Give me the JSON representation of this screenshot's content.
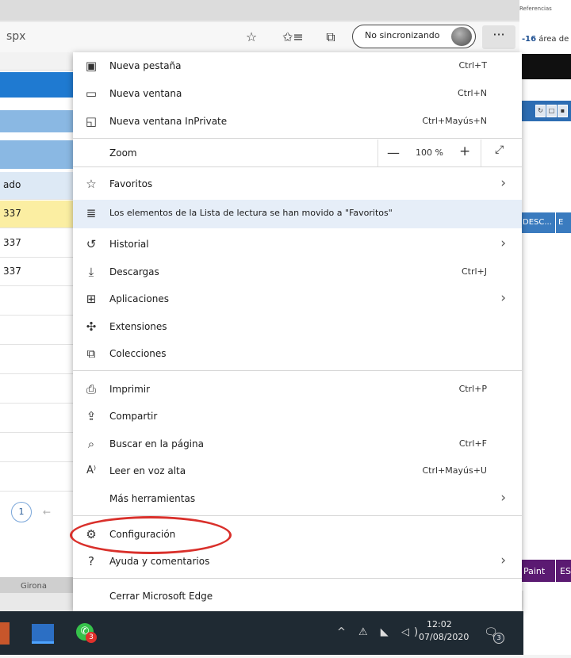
{
  "browser": {
    "url_fragment": "spx",
    "sync_label": "No sincronizando",
    "more_label": "···",
    "toolbar_icons": [
      "star-outline-icon",
      "favorites-bar-icon",
      "collections-icon"
    ]
  },
  "menu": {
    "items": [
      {
        "label": "Nueva pestaña",
        "shortcut": "Ctrl+T",
        "icon": "new-tab-icon",
        "glyph": "▣"
      },
      {
        "label": "Nueva ventana",
        "shortcut": "Ctrl+N",
        "icon": "new-window-icon",
        "glyph": "▭"
      },
      {
        "label": "Nueva ventana InPrivate",
        "shortcut": "Ctrl+Mayús+N",
        "icon": "inprivate-icon",
        "glyph": "◱"
      },
      {
        "label": "Zoom",
        "icon": "",
        "glyph": ""
      },
      {
        "label": "Favoritos",
        "icon": "favorites-icon",
        "glyph": "☆"
      },
      {
        "label": "Los elementos de la Lista de lectura se han movido a \"Favoritos\"",
        "icon": "reading-list-icon",
        "glyph": "≣"
      },
      {
        "label": "Historial",
        "icon": "history-icon",
        "glyph": "↺"
      },
      {
        "label": "Descargas",
        "shortcut": "Ctrl+J",
        "icon": "download-icon",
        "glyph": "⤓"
      },
      {
        "label": "Aplicaciones",
        "icon": "apps-icon",
        "glyph": "⊞"
      },
      {
        "label": "Extensiones",
        "icon": "extensions-icon",
        "glyph": "✣"
      },
      {
        "label": "Colecciones",
        "icon": "collections-icon",
        "glyph": "⧉"
      },
      {
        "label": "Imprimir",
        "shortcut": "Ctrl+P",
        "icon": "print-icon",
        "glyph": "⎙"
      },
      {
        "label": "Compartir",
        "icon": "share-icon",
        "glyph": "⇪"
      },
      {
        "label": "Buscar en la página",
        "shortcut": "Ctrl+F",
        "icon": "find-icon",
        "glyph": "⌕"
      },
      {
        "label": "Leer en voz alta",
        "shortcut": "Ctrl+Mayús+U",
        "icon": "read-aloud-icon",
        "glyph": "A⁾"
      },
      {
        "label": "Más herramientas",
        "icon": "",
        "glyph": ""
      },
      {
        "label": "Configuración",
        "icon": "gear-icon",
        "glyph": "⚙"
      },
      {
        "label": "Ayuda y comentarios",
        "icon": "help-icon",
        "glyph": "?"
      },
      {
        "label": "Cerrar Microsoft Edge",
        "icon": "",
        "glyph": ""
      }
    ],
    "zoom": {
      "minus": "—",
      "value": "100 %",
      "plus": "+",
      "fullscreen": "⤢"
    },
    "chevron": "›"
  },
  "left_page": {
    "rows": [
      "ado",
      "337",
      "337",
      "337"
    ],
    "pager": "1",
    "pager_arrow": "←",
    "bottom_label": "Girona"
  },
  "right_page": {
    "tab_label": "Referencias",
    "area_number": "-16",
    "area_text": " área de",
    "desc_label": "DESC...",
    "desc_label_2": "E",
    "paint_label": "Paint",
    "es_label": "ES"
  },
  "taskbar": {
    "whatsapp_badge": "3",
    "tray_icons": "^ ⚠ ◣ ◁)",
    "time": "12:02",
    "date": "07/08/2020",
    "notification_badge": "3"
  },
  "colors": {
    "highlight_row": "#e6eef8",
    "circle": "#d9302b",
    "taskbar": "#1f2a33",
    "left_blue": "#1f7ad1",
    "left_yellow": "#fbeea2"
  }
}
